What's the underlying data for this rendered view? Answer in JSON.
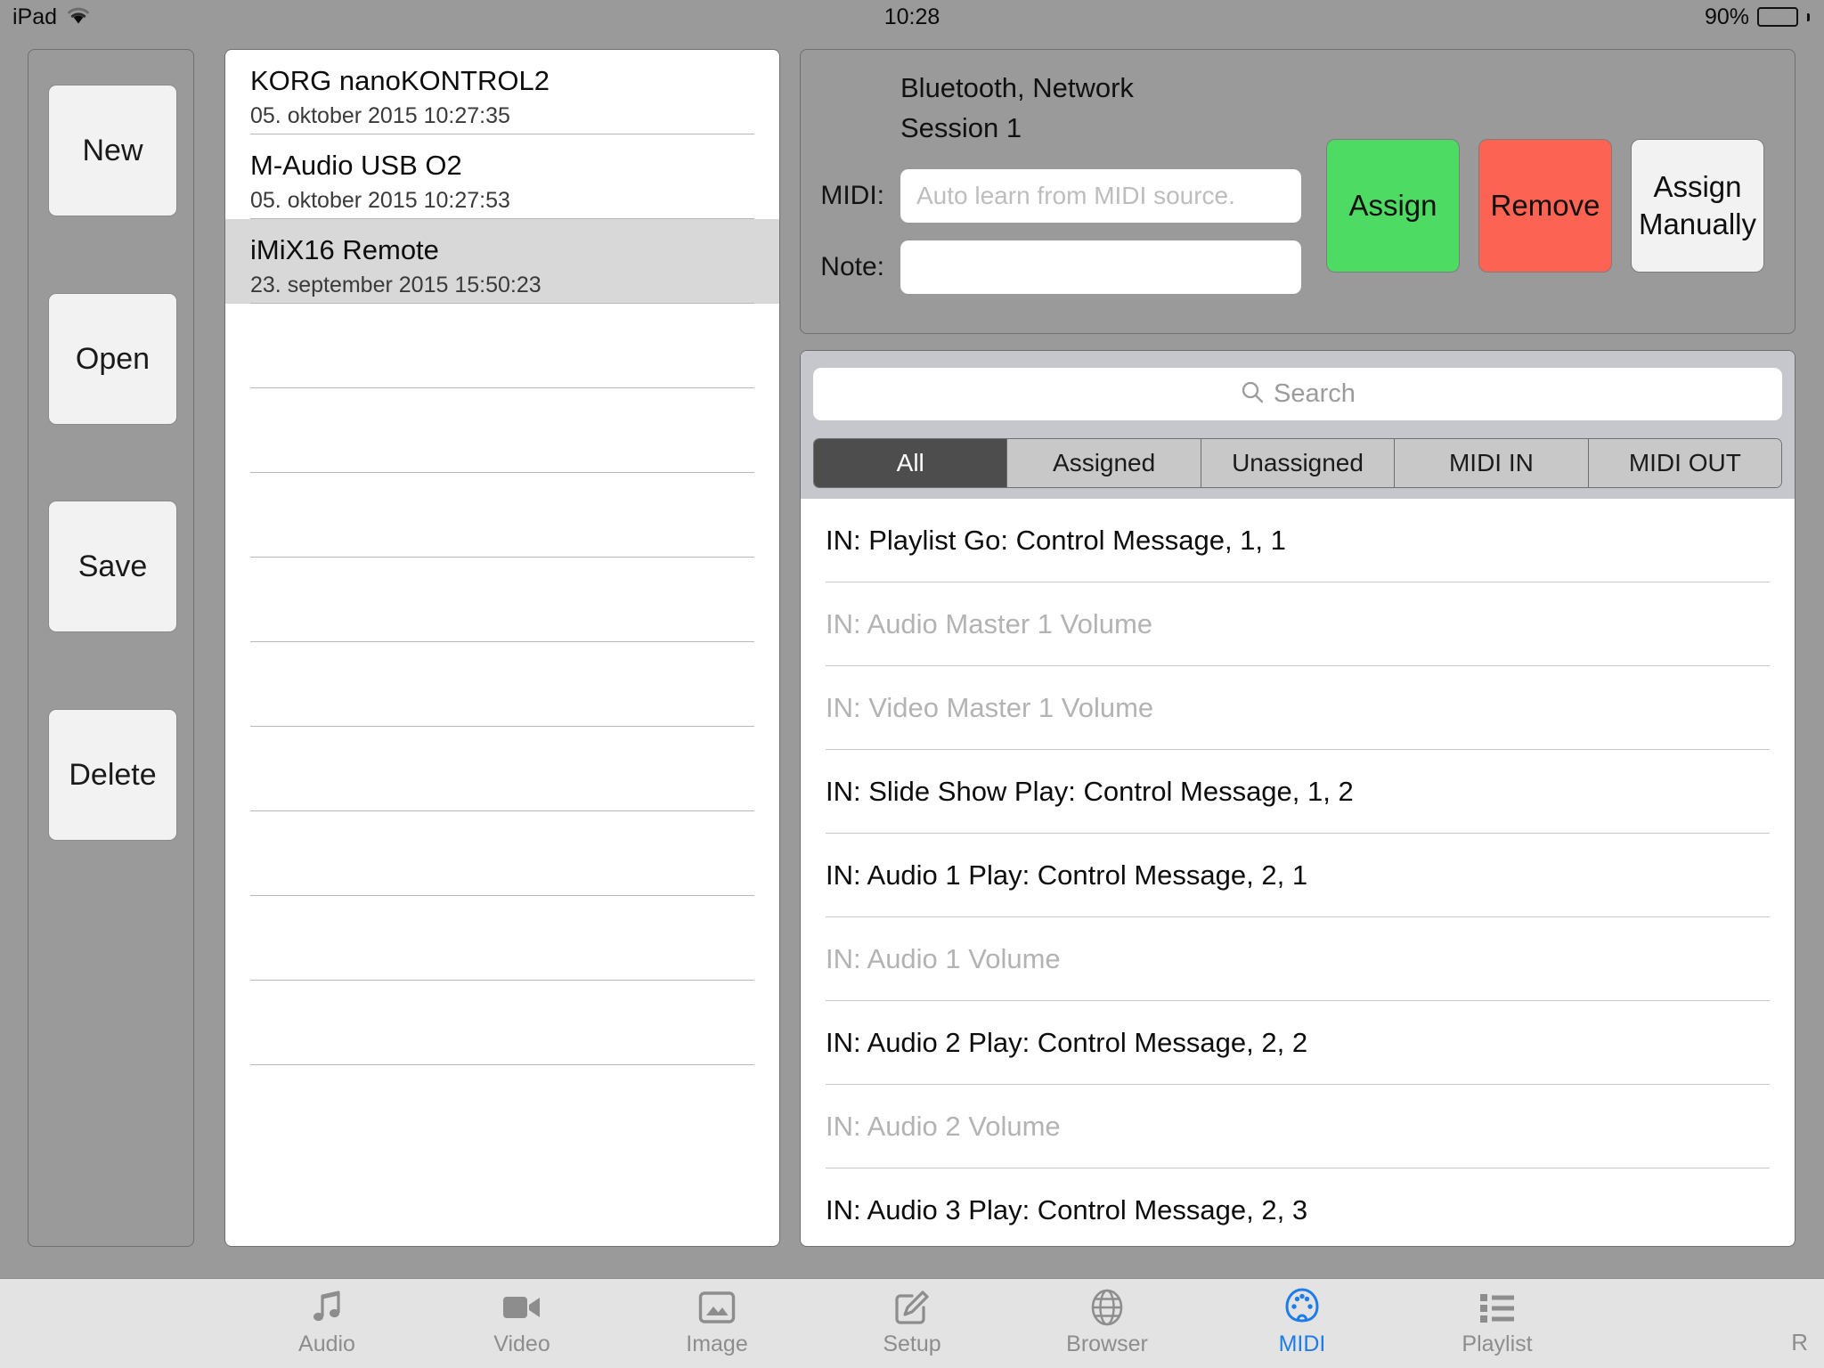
{
  "status_bar": {
    "device_label": "iPad",
    "wifi_icon": "wifi-icon",
    "time": "10:28",
    "battery_percent": "90%",
    "battery_level": 90
  },
  "toolbar": {
    "buttons": [
      {
        "label": "New",
        "name": "new-button"
      },
      {
        "label": "Open",
        "name": "open-button"
      },
      {
        "label": "Save",
        "name": "save-button"
      },
      {
        "label": "Delete",
        "name": "delete-button"
      }
    ]
  },
  "device_list": {
    "items": [
      {
        "name": "KORG nanoKONTROL2",
        "date": "05. oktober 2015 10:27:35",
        "selected": false
      },
      {
        "name": "M-Audio USB O2",
        "date": "05. oktober 2015 10:27:53",
        "selected": false
      },
      {
        "name": "iMiX16 Remote",
        "date": "23. september 2015 15:50:23",
        "selected": true
      }
    ],
    "empty_row_count": 9
  },
  "assign_panel": {
    "title_line_1": "Bluetooth, Network",
    "title_line_2": "Session 1",
    "midi_label": "MIDI:",
    "midi_value": "",
    "midi_placeholder": "Auto learn from MIDI source.",
    "note_label": "Note:",
    "note_value": "",
    "note_placeholder": "",
    "assign_label": "Assign",
    "remove_label": "Remove",
    "assign_manually_label": "Assign\nManually",
    "assign_manually_line_1": "Assign",
    "assign_manually_line_2": "Manually",
    "assign_color": "#4ddb64",
    "remove_color": "#fc6352"
  },
  "mapping": {
    "search_placeholder": "Search",
    "search_value": "",
    "search_icon": "search-icon",
    "filters": [
      {
        "label": "All",
        "active": true
      },
      {
        "label": "Assigned",
        "active": false
      },
      {
        "label": "Unassigned",
        "active": false
      },
      {
        "label": "MIDI IN",
        "active": false
      },
      {
        "label": "MIDI OUT",
        "active": false
      }
    ],
    "rows": [
      {
        "label": "IN: Playlist Go: Control Message, 1, 1",
        "assigned": true
      },
      {
        "label": "IN: Audio Master 1 Volume",
        "assigned": false
      },
      {
        "label": "IN: Video Master 1 Volume",
        "assigned": false
      },
      {
        "label": "IN: Slide Show Play: Control Message, 1, 2",
        "assigned": true
      },
      {
        "label": "IN: Audio 1 Play: Control Message, 2, 1",
        "assigned": true
      },
      {
        "label": "IN: Audio 1 Volume",
        "assigned": false
      },
      {
        "label": "IN: Audio 2 Play: Control Message, 2, 2",
        "assigned": true
      },
      {
        "label": "IN: Audio 2 Volume",
        "assigned": false
      },
      {
        "label": "IN: Audio 3 Play: Control Message, 2, 3",
        "assigned": true
      }
    ]
  },
  "tab_bar": {
    "tabs": [
      {
        "label": "Audio",
        "icon": "music-note-icon",
        "active": false
      },
      {
        "label": "Video",
        "icon": "video-camera-icon",
        "active": false
      },
      {
        "label": "Image",
        "icon": "photo-icon",
        "active": false
      },
      {
        "label": "Setup",
        "icon": "pencil-square-icon",
        "active": false
      },
      {
        "label": "Browser",
        "icon": "globe-icon",
        "active": false
      },
      {
        "label": "MIDI",
        "icon": "midi-din-icon",
        "active": true
      },
      {
        "label": "Playlist",
        "icon": "list-icon",
        "active": false
      }
    ],
    "corner_label": "R",
    "active_color": "#1d7ce8",
    "inactive_color": "#8d8d8d"
  }
}
